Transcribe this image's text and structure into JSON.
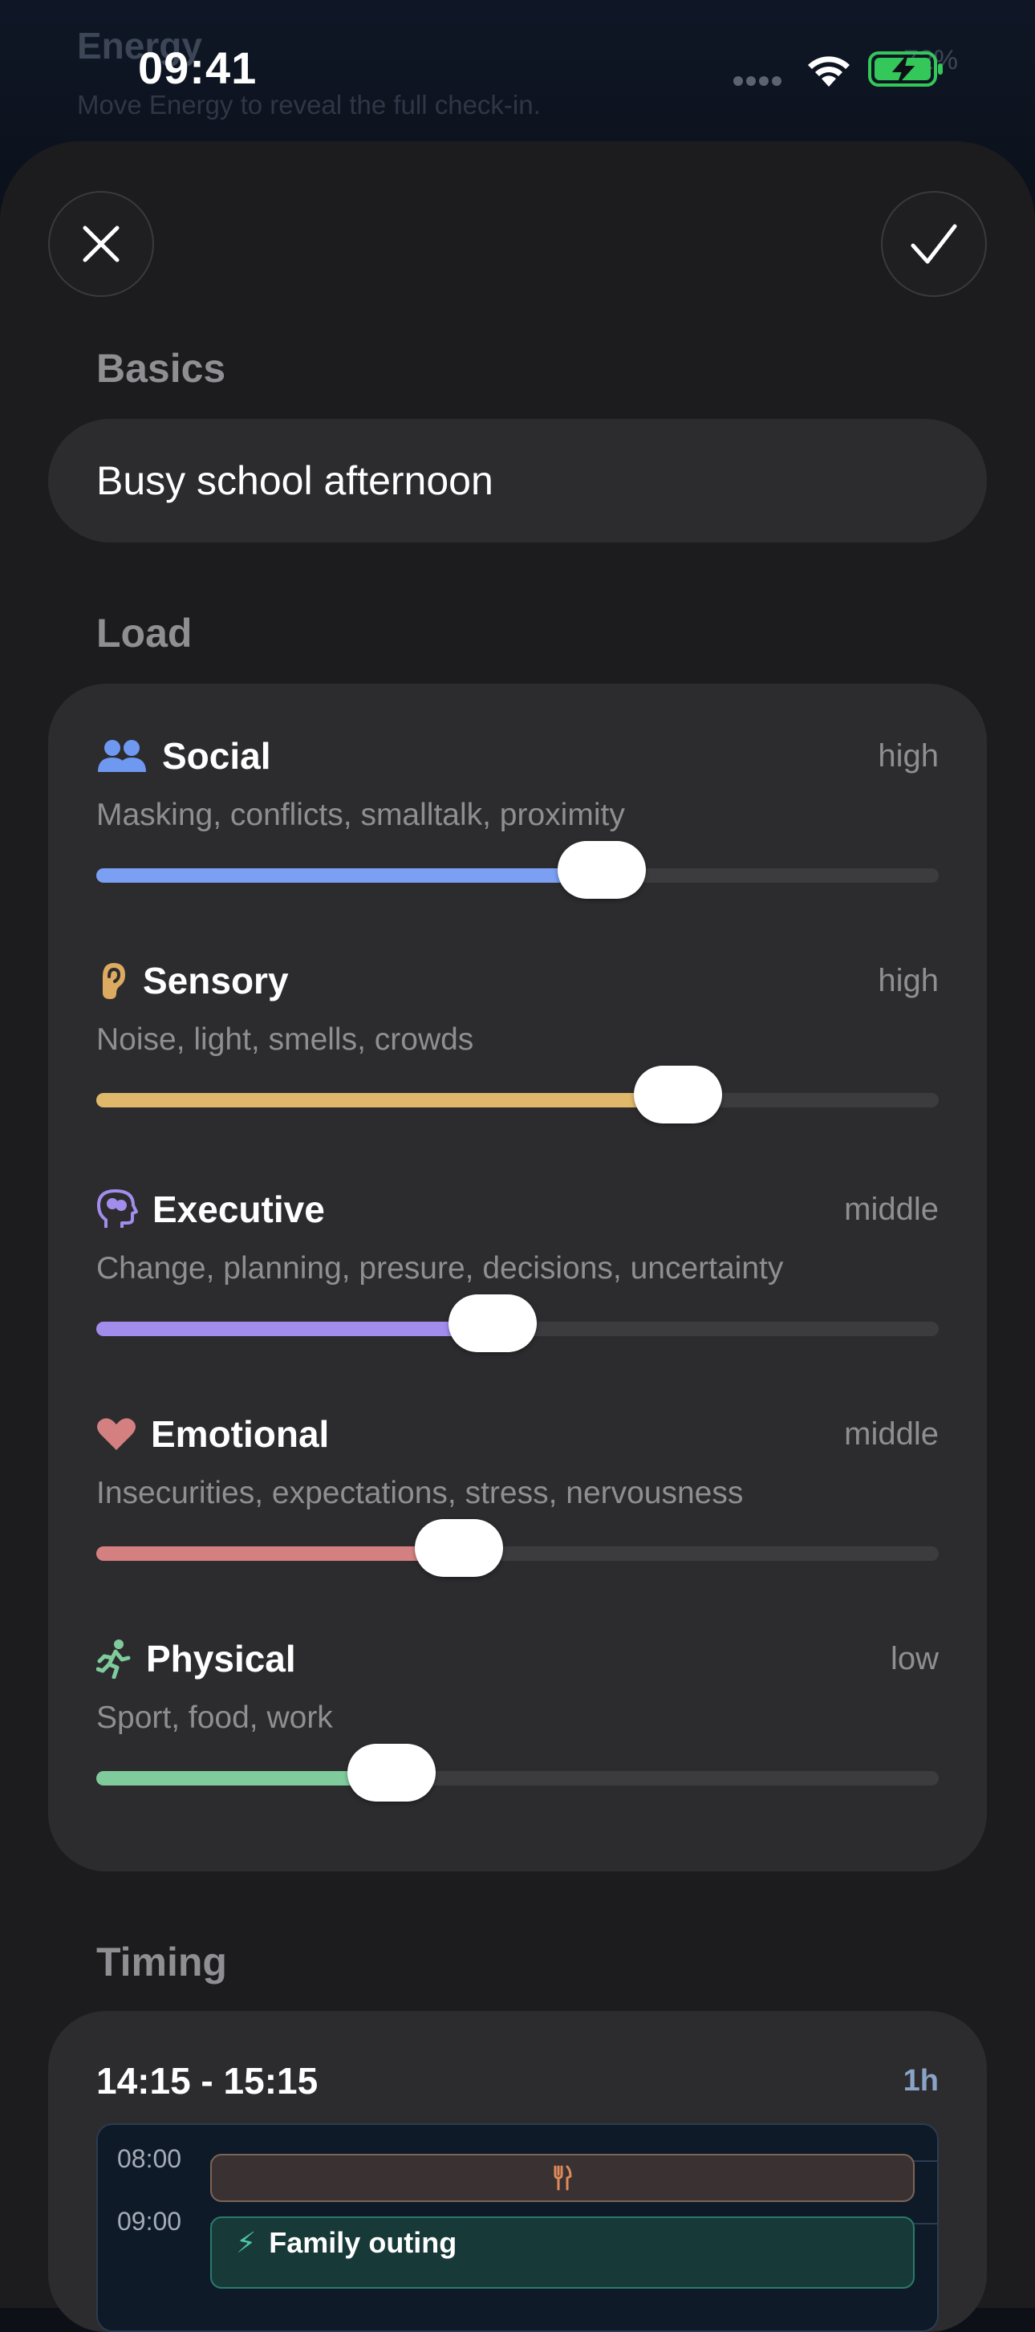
{
  "background": {
    "title": "Energy",
    "subtitle": "Move Energy to reveal the full check-in.",
    "percent": "72%"
  },
  "status_bar": {
    "time": "09:41"
  },
  "sheet": {
    "basics": {
      "title": "Basics",
      "name_value": "Busy school afternoon"
    },
    "load": {
      "title": "Load",
      "items": [
        {
          "label": "Social",
          "level": "high",
          "description": "Masking, conflicts, smalltalk, proximity",
          "value": 0.6,
          "color": "#7b9ff2",
          "icon": "people-icon"
        },
        {
          "label": "Sensory",
          "level": "high",
          "description": "Noise, light, smells, crowds",
          "value": 0.69,
          "color": "#e0b86c",
          "icon": "ear-icon"
        },
        {
          "label": "Executive",
          "level": "middle",
          "description": "Change, planning, presure, decisions, uncertainty",
          "value": 0.47,
          "color": "#a28ded",
          "icon": "brain-head-icon"
        },
        {
          "label": "Emotional",
          "level": "middle",
          "description": "Insecurities, expectations, stress, nervousness",
          "value": 0.43,
          "color": "#d48080",
          "icon": "heart-icon"
        },
        {
          "label": "Physical",
          "level": "low",
          "description": "Sport, food, work",
          "value": 0.35,
          "color": "#7fcb9c",
          "icon": "running-icon"
        }
      ]
    },
    "timing": {
      "title": "Timing",
      "range": "14:15 - 15:15",
      "duration": "1h",
      "hours": [
        "08:00",
        "09:00"
      ],
      "events": [
        {
          "name": "",
          "icon": "fork-knife-icon"
        },
        {
          "name": "Family outing",
          "icon": "bolt-icon"
        }
      ]
    }
  }
}
